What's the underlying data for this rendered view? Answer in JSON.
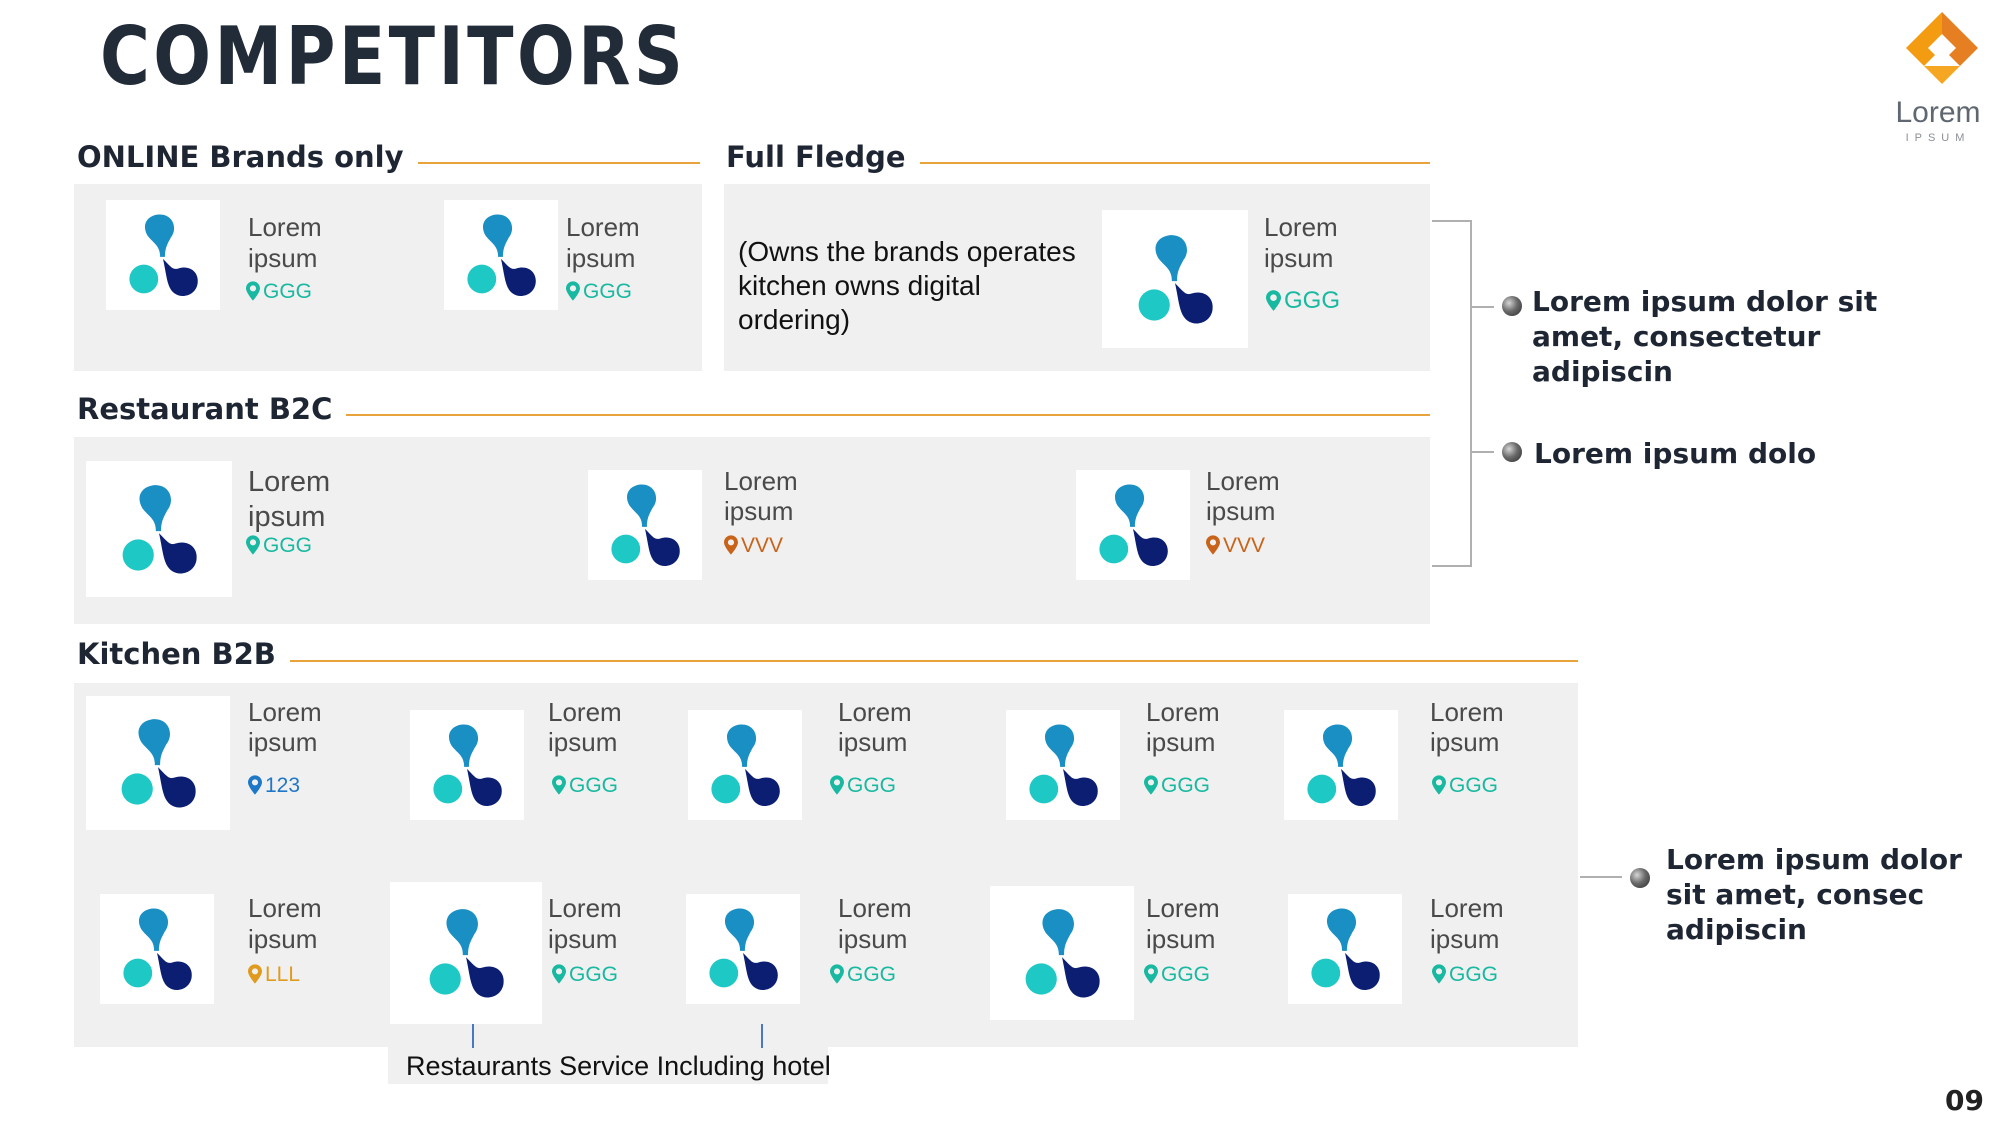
{
  "title": "COMPETITORS",
  "logo": {
    "name": "Lorem",
    "sub": "IPSUM",
    "icon": "orange-geometric-logo-icon"
  },
  "page_number": "09",
  "colors": {
    "accent_line": "#e8a33b",
    "green_loc": "#18b9a0",
    "orange_loc": "#c8641a",
    "amber_loc": "#e09a1e",
    "blue_loc": "#1f77c8"
  },
  "sections": {
    "online": {
      "label": "ONLINE Brands only",
      "brands": [
        {
          "name1": "Lorem",
          "name2": "ipsum",
          "loc": "GGG"
        },
        {
          "name1": "Lorem",
          "name2": "ipsum",
          "loc": "GGG"
        }
      ]
    },
    "full": {
      "label": "Full Fledge",
      "note": "(Owns the brands operates kitchen owns digital ordering)",
      "brand": {
        "name1": "Lorem",
        "name2": "ipsum",
        "loc": "GGG"
      }
    },
    "b2c": {
      "label": "Restaurant B2C",
      "brands": [
        {
          "name1": "Lorem",
          "name2": "ipsum",
          "loc": "GGG"
        },
        {
          "name1": "Lorem",
          "name2": "ipsum",
          "loc": "VVV"
        },
        {
          "name1": "Lorem",
          "name2": "ipsum",
          "loc": "VVV"
        }
      ]
    },
    "b2b": {
      "label": "Kitchen B2B",
      "row1": [
        {
          "name1": "Lorem",
          "name2": "ipsum",
          "loc": "123"
        },
        {
          "name1": "Lorem",
          "name2": "ipsum",
          "loc": "GGG"
        },
        {
          "name1": "Lorem",
          "name2": "ipsum",
          "loc": "GGG"
        },
        {
          "name1": "Lorem",
          "name2": "ipsum",
          "loc": "GGG"
        },
        {
          "name1": "Lorem",
          "name2": "ipsum",
          "loc": "GGG"
        }
      ],
      "row2": [
        {
          "name1": "Lorem",
          "name2": "ipsum",
          "loc": "LLL"
        },
        {
          "name1": "Lorem",
          "name2": "ipsum",
          "loc": "GGG"
        },
        {
          "name1": "Lorem",
          "name2": "ipsum",
          "loc": "GGG"
        },
        {
          "name1": "Lorem",
          "name2": "ipsum",
          "loc": "GGG"
        },
        {
          "name1": "Lorem",
          "name2": "ipsum",
          "loc": "GGG"
        }
      ],
      "footnote": "Restaurants Service Including hotel"
    }
  },
  "callouts": [
    "Lorem ipsum dolor sit amet, consectetur adipiscin",
    "Lorem ipsum dolo",
    "Lorem ipsum dolor sit amet, consec adipiscin"
  ]
}
